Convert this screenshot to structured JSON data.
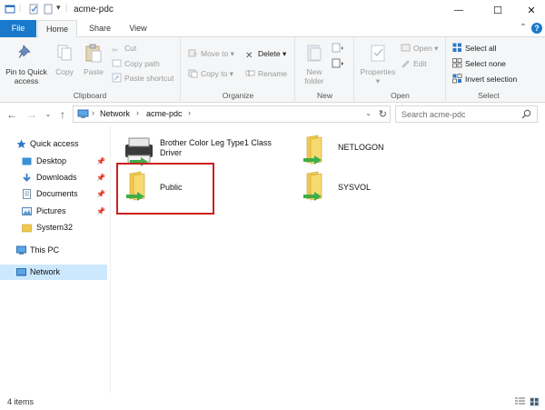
{
  "window": {
    "title": "acme-pdc",
    "minimize_glyph": "—",
    "maximize_glyph": "☐",
    "close_glyph": "✕"
  },
  "ribbon_tabs": [
    "File",
    "Home",
    "Share",
    "View"
  ],
  "ribbon": {
    "clipboard": {
      "label": "Clipboard",
      "pin_label_line1": "Pin to Quick",
      "pin_label_line2": "access",
      "copy": "Copy",
      "paste": "Paste",
      "cut": "Cut",
      "copy_path": "Copy path",
      "paste_shortcut": "Paste shortcut"
    },
    "organize": {
      "label": "Organize",
      "move_to": "Move to",
      "copy_to": "Copy to",
      "delete": "Delete",
      "rename": "Rename"
    },
    "new": {
      "label": "New",
      "new_folder_line1": "New",
      "new_folder_line2": "folder"
    },
    "open": {
      "label": "Open",
      "properties": "Properties",
      "open": "Open",
      "edit": "Edit"
    },
    "select": {
      "label": "Select",
      "select_all": "Select all",
      "select_none": "Select none",
      "invert_selection": "Invert selection"
    }
  },
  "address": {
    "crumbs": [
      "Network",
      "acme-pdc"
    ],
    "search_placeholder": "Search acme-pdc"
  },
  "nav_pane": {
    "quick_access": "Quick access",
    "items": [
      "Desktop",
      "Downloads",
      "Documents",
      "Pictures",
      "System32"
    ],
    "this_pc": "This PC",
    "network": "Network"
  },
  "content": {
    "printer_line1": "Brother Color Leg Type1 Class",
    "printer_line2": "Driver",
    "netlogon": "NETLOGON",
    "public": "Public",
    "sysvol": "SYSVOL"
  },
  "status": {
    "item_count": "4 items"
  },
  "colors": {
    "accent": "#1979ca",
    "selection": "#cce8ff",
    "highlight_box": "#cc1f1f",
    "folder": "#f0c94e"
  }
}
